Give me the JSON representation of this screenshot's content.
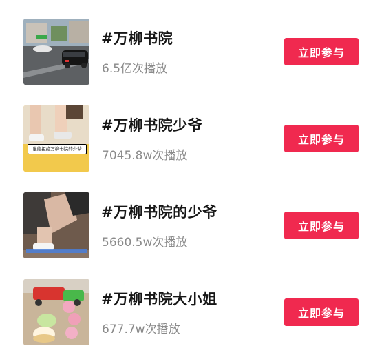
{
  "topics": [
    {
      "title": "#万柳书院",
      "plays": "6.5亿次播放",
      "button": "立即参与"
    },
    {
      "title": "#万柳书院少爷",
      "plays": "7045.8w次播放",
      "button": "立即参与",
      "thumb_caption": "谁能拒绝万柳书院的少爷"
    },
    {
      "title": "#万柳书院的少爷",
      "plays": "5660.5w次播放",
      "button": "立即参与"
    },
    {
      "title": "#万柳书院大小姐",
      "plays": "677.7w次播放",
      "button": "立即参与"
    }
  ],
  "colors": {
    "button": "#f0294f",
    "title": "#161616",
    "meta": "#8a8a8a"
  }
}
